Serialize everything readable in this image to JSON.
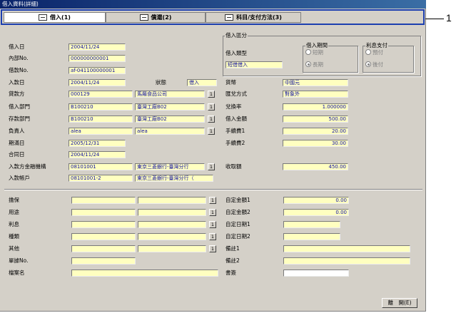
{
  "window": {
    "title": "借入資料(詳細)"
  },
  "tabs": [
    {
      "label": "借入(1)"
    },
    {
      "label": "償還(2)"
    },
    {
      "label": "科目/支付方法(3)"
    }
  ],
  "callout": "1",
  "form": {
    "borrow_date": {
      "label": "借入日",
      "value": "2004/11/24"
    },
    "internal_no": {
      "label": "內部No.",
      "value": "000000000001"
    },
    "loan_no": {
      "label": "借款No.",
      "value": "af-041100000001"
    },
    "receipt_date": {
      "label": "入款日",
      "value": "2004/11/24"
    },
    "status": {
      "label": "狀態",
      "value": "借入"
    },
    "currency": {
      "label": "貨幣",
      "value": "中國元"
    },
    "lender": {
      "label": "貸款方",
      "code": "000129",
      "name": "馬羅食品公司"
    },
    "fx_method": {
      "label": "匯兌方式",
      "value": "對象外"
    },
    "borrow_dept": {
      "label": "借入部門",
      "code": "B100210",
      "name": "臺灣工廠B02"
    },
    "fx_rate": {
      "label": "兌換率",
      "value": "1.000000"
    },
    "deposit_dept": {
      "label": "存款部門",
      "code": "B100210",
      "name": "臺灣工廠B02"
    },
    "borrow_amount": {
      "label": "借入金額",
      "value": "500.00"
    },
    "manager": {
      "label": "負責人",
      "code": "alea",
      "name": "alea"
    },
    "fee1": {
      "label": "手續費1",
      "value": "20.00"
    },
    "due_date": {
      "label": "期滿日",
      "value": "2005/12/31"
    },
    "fee2": {
      "label": "手續費2",
      "value": "30.00"
    },
    "contract_date": {
      "label": "合同日",
      "value": "2004/11/24"
    },
    "bank": {
      "label": "入款方金融機構",
      "code": "08101001",
      "name": "東京三菱銀行-臺灣分行"
    },
    "received": {
      "label": "收取額",
      "value": "450.00"
    },
    "bank_account": {
      "label": "入款帳戶",
      "code": "08101001-2",
      "name": "東京三菱銀行-臺灣分行（"
    },
    "pick_label": "1"
  },
  "borrow_class": {
    "title": "借入區分",
    "type_label": "借入類型",
    "type_value": "短借借入",
    "period": {
      "title": "借入期間",
      "short": "短期",
      "long": "長期",
      "selected": "long"
    },
    "interest": {
      "title": "利息支付",
      "advance": "預付",
      "arrears": "後付",
      "selected": "arrears"
    }
  },
  "extra": {
    "guarantee": {
      "label": "擔保"
    },
    "purpose": {
      "label": "用途"
    },
    "interest": {
      "label": "利息"
    },
    "kind": {
      "label": "種類"
    },
    "other": {
      "label": "其他"
    },
    "doc_no": {
      "label": "單據No."
    },
    "file_name": {
      "label": "檔案名"
    },
    "custom_amount1": {
      "label": "自定金額1",
      "value": "0.00"
    },
    "custom_amount2": {
      "label": "自定金額2",
      "value": "0.00"
    },
    "custom_date1": {
      "label": "自定日期1"
    },
    "custom_date2": {
      "label": "自定日期2"
    },
    "note1": {
      "label": "備註1"
    },
    "note2": {
      "label": "備註2"
    },
    "document": {
      "label": "書簽"
    }
  },
  "footer": {
    "close_label": "離　開(E)"
  }
}
